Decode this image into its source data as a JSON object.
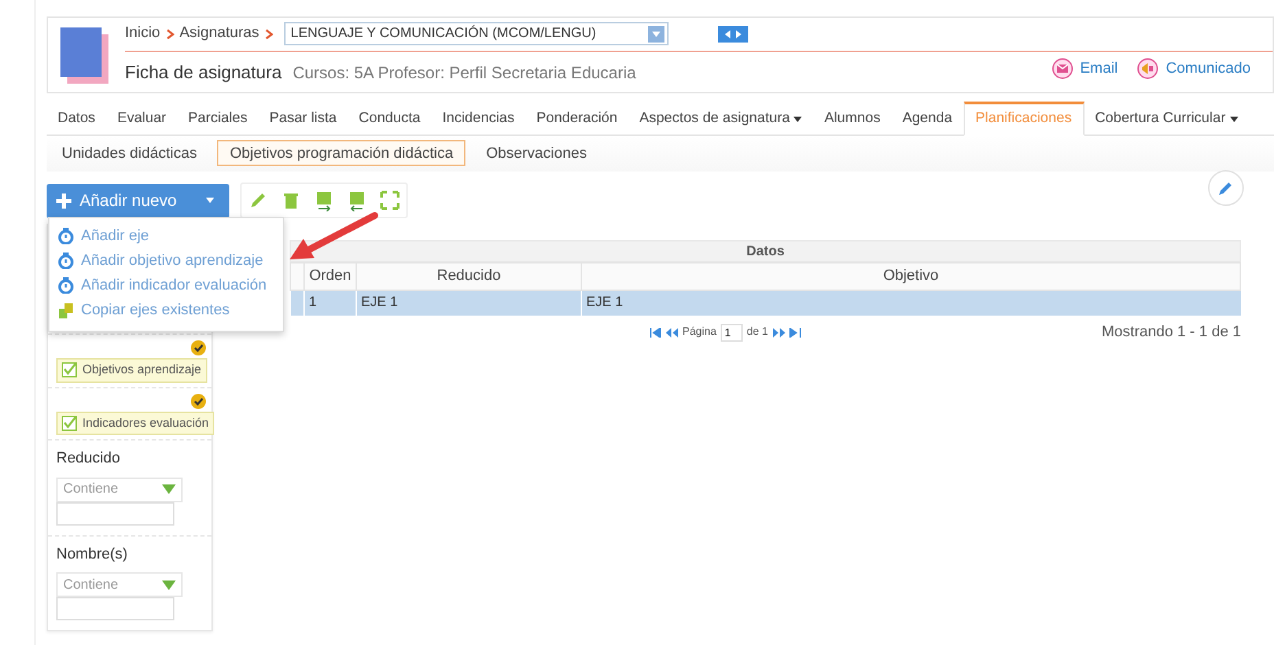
{
  "header": {
    "breadcrumb": [
      {
        "label": "Inicio"
      },
      {
        "label": "Asignaturas"
      }
    ],
    "subject": "LENGUAJE Y COMUNICACIÓN (MCOM/LENGU)",
    "title": "Ficha de asignatura",
    "subtitle": "Cursos: 5A Profesor: Perfil Secretaria Educaria",
    "actions": [
      {
        "kind": "email",
        "label": "Email"
      },
      {
        "kind": "notice",
        "label": "Comunicado"
      }
    ]
  },
  "tabs": [
    {
      "label": "Datos",
      "selected": false,
      "dropdown": false
    },
    {
      "label": "Evaluar",
      "selected": false,
      "dropdown": false
    },
    {
      "label": "Parciales",
      "selected": false,
      "dropdown": false
    },
    {
      "label": "Pasar lista",
      "selected": false,
      "dropdown": false
    },
    {
      "label": "Conducta",
      "selected": false,
      "dropdown": false
    },
    {
      "label": "Incidencias",
      "selected": false,
      "dropdown": false
    },
    {
      "label": "Ponderación",
      "selected": false,
      "dropdown": false
    },
    {
      "label": "Aspectos de asignatura",
      "selected": false,
      "dropdown": true
    },
    {
      "label": "Alumnos",
      "selected": false,
      "dropdown": false
    },
    {
      "label": "Agenda",
      "selected": false,
      "dropdown": false
    },
    {
      "label": "Planificaciones",
      "selected": true,
      "dropdown": false
    },
    {
      "label": "Cobertura Curricular",
      "selected": false,
      "dropdown": true
    }
  ],
  "subtabs": [
    {
      "label": "Unidades didácticas",
      "selected": false
    },
    {
      "label": "Objetivos programación didáctica",
      "selected": true
    },
    {
      "label": "Observaciones",
      "selected": false
    }
  ],
  "add_button": {
    "label": "Añadir nuevo"
  },
  "menu": [
    {
      "kind": "timer",
      "label": "Añadir eje"
    },
    {
      "kind": "timer",
      "label": "Añadir objetivo aprendizaje"
    },
    {
      "kind": "timer",
      "label": "Añadir indicador evaluación"
    },
    {
      "kind": "copy",
      "label": "Copiar ejes existentes"
    }
  ],
  "filters": [
    {
      "kind": "check",
      "label": "Objetivos aprendizaje",
      "checked": true
    },
    {
      "kind": "check",
      "label": "Indicadores evaluación",
      "checked": true
    },
    {
      "kind": "text",
      "label": "Reducido",
      "operator": "Contiene"
    },
    {
      "kind": "text",
      "label": "Nombre(s)",
      "operator": "Contiene"
    }
  ],
  "table": {
    "group": "Datos",
    "columns": [
      "Orden",
      "Reducido",
      "Objetivo"
    ],
    "rows": [
      {
        "selected": true,
        "cells": [
          "1",
          "EJE 1",
          "EJE 1"
        ]
      }
    ]
  },
  "pager": {
    "page_label": "Página",
    "page": "1",
    "of_label": "de 1",
    "summary": "Mostrando 1 - 1 de 1"
  }
}
